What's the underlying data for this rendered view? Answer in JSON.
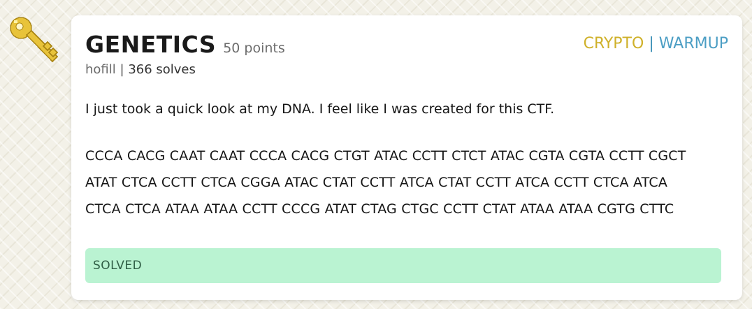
{
  "challenge": {
    "title": "GENETICS",
    "points": "50 points",
    "author": "hofill",
    "separator": "|",
    "solves": "366 solves",
    "tags": {
      "category": "CRYPTO",
      "divider": "|",
      "difficulty": "WARMUP"
    },
    "description": {
      "intro": "I just took a quick look at my DNA. I feel like I was created for this CTF.",
      "dna_lines": [
        "CCCA CACG CAAT CAAT CCCA CACG CTGT ATAC CCTT CTCT ATAC CGTA CGTA CCTT CGCT",
        "ATAT CTCA CCTT CTCA CGGA ATAC CTAT CCTT ATCA CTAT CCTT ATCA CCTT CTCA ATCA",
        "CTCA CTCA ATAA ATAA CCTT CCCG ATAT CTAG CTGC CCTT CTAT ATAA ATAA CGTG CTTC"
      ]
    },
    "status": "SOLVED"
  },
  "icon": "key-icon",
  "colors": {
    "crypto_tag": "#cfb12a",
    "warmup_tag": "#4c9ec4",
    "solved_bg": "#baf3d2",
    "key_gold": "#e8c33a"
  }
}
